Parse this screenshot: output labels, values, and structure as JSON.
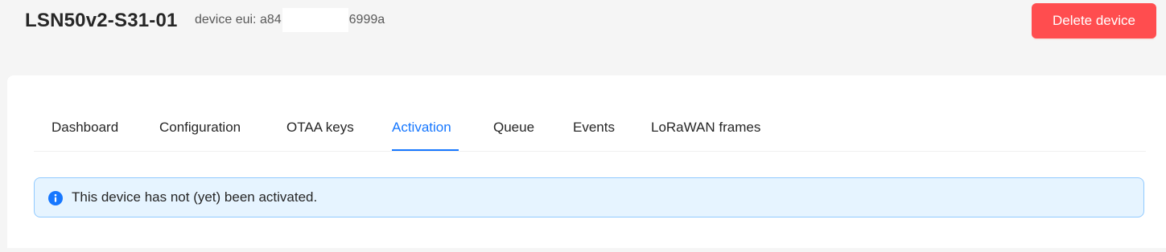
{
  "header": {
    "device_name": "LSN50v2-S31-01",
    "eui_prefix": "device eui: a84",
    "eui_suffix": "6999a",
    "delete_label": "Delete device"
  },
  "tabs": [
    {
      "label": "Dashboard",
      "active": false
    },
    {
      "label": "Configuration",
      "active": false
    },
    {
      "label": "OTAA keys",
      "active": false
    },
    {
      "label": "Activation",
      "active": true
    },
    {
      "label": "Queue",
      "active": false
    },
    {
      "label": "Events",
      "active": false
    },
    {
      "label": "LoRaWAN frames",
      "active": false
    }
  ],
  "alert": {
    "icon": "info-icon",
    "message": "This device has not (yet) been activated."
  },
  "colors": {
    "danger": "#ff4d4f",
    "primary": "#1677ff",
    "info_background": "#e6f4ff",
    "info_border": "#91caff"
  }
}
